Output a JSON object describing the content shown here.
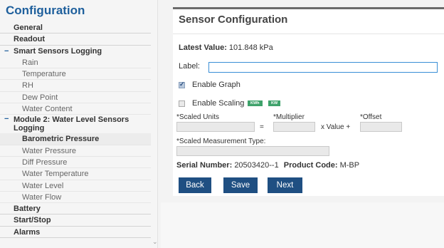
{
  "sidebar": {
    "title": "Configuration",
    "items": {
      "general": "General",
      "readout": "Readout",
      "smart_sensors_logging": "Smart Sensors Logging",
      "rain": "Rain",
      "temperature": "Temperature",
      "rh": "RH",
      "dew_point": "Dew Point",
      "water_content": "Water Content",
      "module2": "Module 2: Water Level Sensors Logging",
      "barometric_pressure": "Barometric Pressure",
      "water_pressure": "Water Pressure",
      "diff_pressure": "Diff Pressure",
      "water_temperature": "Water Temperature",
      "water_level": "Water Level",
      "water_flow": "Water Flow",
      "battery": "Battery",
      "start_stop": "Start/Stop",
      "alarms": "Alarms"
    },
    "group_marker": "−",
    "scroll_arrow": "⌄"
  },
  "panel": {
    "title": "Sensor Configuration",
    "latest_label": "Latest Value:",
    "latest_value": "101.848 kPa",
    "label_field": {
      "label": "Label:",
      "value": ""
    },
    "enable_graph": {
      "label": "Enable Graph",
      "checked": true
    },
    "enable_scaling": {
      "label": "Enable Scaling",
      "checked": false
    },
    "badges": {
      "kwh": "KWh",
      "kw": "KW"
    },
    "scaled_units": {
      "label": "*Scaled Units",
      "value": ""
    },
    "multiplier": {
      "label": "*Multiplier",
      "value": ""
    },
    "offset": {
      "label": "*Offset",
      "value": ""
    },
    "equals": "=",
    "x_value_plus": "x Value +",
    "scaled_type": {
      "label": "*Scaled Measurement Type:",
      "value": ""
    },
    "serial_label": "Serial Number:",
    "serial_value": "20503420--1",
    "product_label": "Product Code:",
    "product_value": "M-BP",
    "buttons": {
      "back": "Back",
      "save": "Save",
      "next": "Next"
    }
  },
  "colors": {
    "accent_blue": "#1e5f9c",
    "button_blue": "#1f4f82",
    "badge_green": "#3fa26b",
    "input_focus_border": "#3a8fd6"
  }
}
